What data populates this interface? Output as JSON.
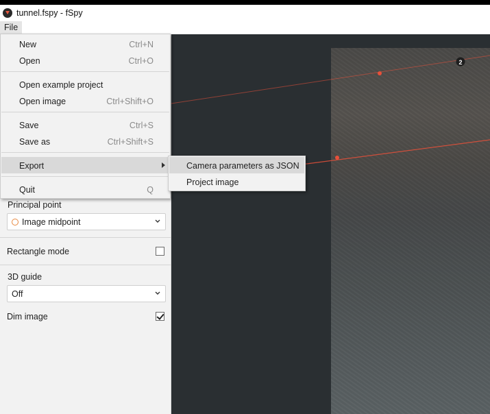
{
  "window": {
    "title": "tunnel.fspy - fSpy"
  },
  "menubar": {
    "file_label": "File"
  },
  "file_menu": {
    "items": [
      {
        "label": "New",
        "shortcut": "Ctrl+N"
      },
      {
        "label": "Open",
        "shortcut": "Ctrl+O"
      },
      {
        "label": "Open example project",
        "shortcut": ""
      },
      {
        "label": "Open image",
        "shortcut": "Ctrl+Shift+O"
      },
      {
        "label": "Save",
        "shortcut": "Ctrl+S"
      },
      {
        "label": "Save as",
        "shortcut": "Ctrl+Shift+S"
      },
      {
        "label": "Export",
        "shortcut": ""
      },
      {
        "label": "Quit",
        "shortcut": "Q"
      }
    ]
  },
  "export_submenu": {
    "items": [
      {
        "label": "Camera parameters as JSON"
      },
      {
        "label": "Project image"
      }
    ]
  },
  "sidebar": {
    "principal_point_label": "Principal point",
    "principal_point_value": "Image midpoint",
    "rectangle_mode_label": "Rectangle mode",
    "rectangle_mode_checked": false,
    "guide_label": "3D guide",
    "guide_value": "Off",
    "dim_image_label": "Dim image",
    "dim_image_checked": true
  },
  "canvas": {
    "control_point_label": "2",
    "line_color": "#e8503a"
  },
  "colors": {
    "accent_orange": "#e8883f",
    "canvas_bg": "#2a2f32",
    "menu_bg": "#f2f2f2"
  }
}
